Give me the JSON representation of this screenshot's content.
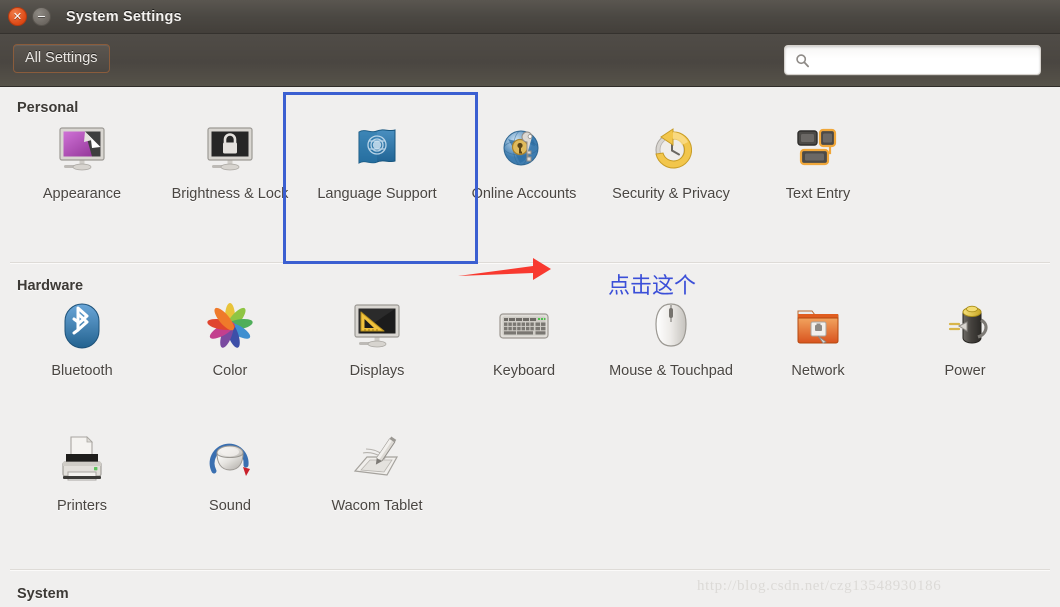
{
  "window": {
    "title": "System Settings",
    "close_icon": "close-icon",
    "minimize_icon": "minimize-icon"
  },
  "toolbar": {
    "all_settings_label": "All Settings",
    "search_icon": "search-icon",
    "search_value": "",
    "search_placeholder": ""
  },
  "sections": [
    {
      "id": "personal",
      "title": "Personal",
      "items": [
        {
          "label": "Appearance",
          "icon": "appearance-icon"
        },
        {
          "label": "Brightness & Lock",
          "icon": "brightness-lock-icon"
        },
        {
          "label": "Language Support",
          "icon": "language-support-icon"
        },
        {
          "label": "Online Accounts",
          "icon": "online-accounts-icon"
        },
        {
          "label": "Security & Privacy",
          "icon": "security-privacy-icon"
        },
        {
          "label": "Text Entry",
          "icon": "text-entry-icon"
        }
      ]
    },
    {
      "id": "hardware",
      "title": "Hardware",
      "items": [
        {
          "label": "Bluetooth",
          "icon": "bluetooth-icon"
        },
        {
          "label": "Color",
          "icon": "color-icon"
        },
        {
          "label": "Displays",
          "icon": "displays-icon"
        },
        {
          "label": "Keyboard",
          "icon": "keyboard-icon"
        },
        {
          "label": "Mouse & Touchpad",
          "icon": "mouse-touchpad-icon"
        },
        {
          "label": "Network",
          "icon": "network-icon"
        },
        {
          "label": "Power",
          "icon": "power-icon"
        },
        {
          "label": "Printers",
          "icon": "printers-icon"
        },
        {
          "label": "Sound",
          "icon": "sound-icon"
        },
        {
          "label": "Wacom Tablet",
          "icon": "wacom-tablet-icon"
        }
      ]
    },
    {
      "id": "system",
      "title": "System",
      "items": []
    }
  ],
  "annotations": {
    "highlight_target": "Language Support",
    "highlight_color": "#3b5fd1",
    "arrow_color": "#f8392f",
    "note_text": "点击这个",
    "note_color": "#3b4fd8",
    "watermark_text": "http://blog.csdn.net/czg13548930186"
  }
}
